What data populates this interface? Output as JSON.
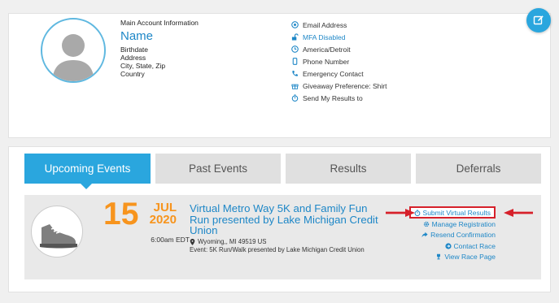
{
  "profile": {
    "account_label": "Main Account Information",
    "name": "Name",
    "birthdate": "Birthdate",
    "address": "Address",
    "city_state_zip": "City, State, Zip",
    "country": "Country"
  },
  "contact": {
    "email": "Email Address",
    "mfa": "MFA Disabled",
    "timezone": "America/Detroit",
    "phone": "Phone Number",
    "emergency": "Emergency Contact",
    "giveaway": "Giveaway Preference: Shirt",
    "send_results": "Send My Results to"
  },
  "tabs": [
    {
      "label": "Upcoming Events"
    },
    {
      "label": "Past Events"
    },
    {
      "label": "Results"
    },
    {
      "label": "Deferrals"
    }
  ],
  "event": {
    "day": "15",
    "month": "JUL",
    "year": "2020",
    "time": "6:00am EDT",
    "title": "Virtual Metro Way 5K and Family Fun Run presented by Lake Michigan Credit Union",
    "location": "Wyoming,, MI 49519 US",
    "description": "Event: 5K Run/Walk presented by Lake Michigan Credit Union",
    "actions": {
      "submit": "Submit Virtual Results",
      "manage": "Manage Registration",
      "resend": "Resend Confirmation",
      "contact": "Contact Race",
      "view": "View Race Page"
    }
  },
  "colors": {
    "accent": "#2aa6de",
    "link": "#1e87c7",
    "date": "#f7941d",
    "highlight": "#d6202a"
  }
}
